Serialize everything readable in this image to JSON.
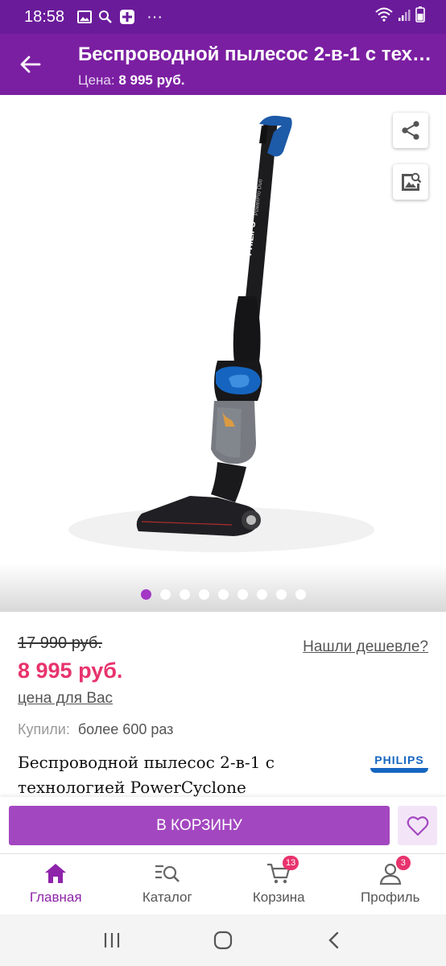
{
  "status_bar": {
    "time": "18:58",
    "notification_icons": [
      "image-icon",
      "search-icon",
      "app-icon",
      "more-icon"
    ],
    "system_icons": [
      "wifi-icon",
      "signal-icon",
      "battery-icon"
    ]
  },
  "header": {
    "title": "Беспроводной пылесос 2-в-1 с технологией PowerCyclone",
    "price_label": "Цена:",
    "price_value": "8 995 руб."
  },
  "gallery": {
    "image_count": 9,
    "active_index": 0,
    "product_brand_text": "PHILIPS",
    "product_model_text": "PowerPro Duo"
  },
  "pricing": {
    "old_price": "17 990 руб.",
    "new_price": "8 995 руб.",
    "price_note": "цена для Вас",
    "cheaper_link": "Нашли дешевле?"
  },
  "stats": {
    "bought_label": "Купили:",
    "bought_value": "более 600 раз"
  },
  "product": {
    "title": "Беспроводной пылесос 2-в-1 с технологией PowerCyclone",
    "brand": "PHILIPS"
  },
  "actions": {
    "cart_label": "В КОРЗИНУ"
  },
  "nav": {
    "items": [
      {
        "label": "Главная",
        "icon": "home-icon",
        "active": true
      },
      {
        "label": "Каталог",
        "icon": "catalog-search-icon"
      },
      {
        "label": "Корзина",
        "icon": "cart-icon",
        "badge": "13"
      },
      {
        "label": "Профиль",
        "icon": "profile-icon",
        "badge": "3"
      }
    ]
  },
  "colors": {
    "primary": "#7b1fa2",
    "status_bar": "#6a1b9a",
    "accent": "#a347c0",
    "price": "#e8336d"
  }
}
